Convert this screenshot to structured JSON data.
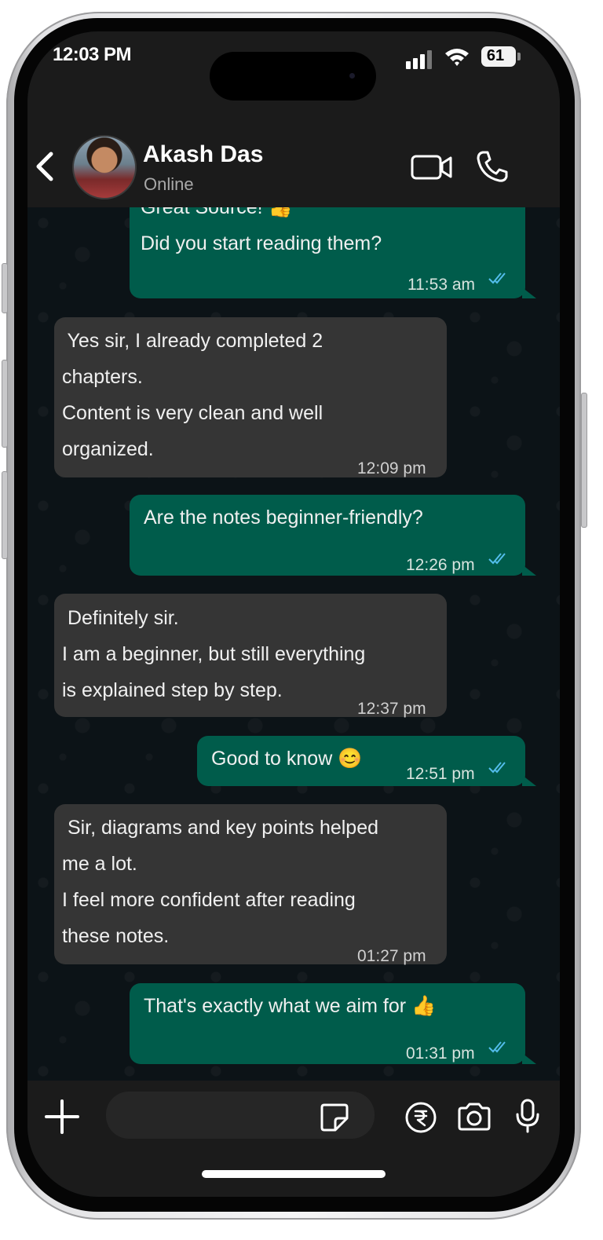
{
  "status_bar": {
    "time": "12:03 PM",
    "battery": "61"
  },
  "header": {
    "contact_name": "Akash Das",
    "contact_status": "Online"
  },
  "messages": [
    {
      "direction": "out",
      "text": "Great Source! 👍\nDid you start reading them?",
      "time": "11:53 am",
      "read": true
    },
    {
      "direction": "in",
      "text": " Yes sir, I already completed 2\nchapters.\nContent is very clean and well\norganized.",
      "time": "12:09 pm"
    },
    {
      "direction": "out",
      "text": "Are the notes beginner-friendly?",
      "time": "12:26 pm",
      "read": true
    },
    {
      "direction": "in",
      "text": " Definitely sir.\nI am a beginner, but still everything\nis explained step by step.",
      "time": "12:37 pm"
    },
    {
      "direction": "out",
      "text": "Good to know 😊",
      "time": "12:51 pm",
      "read": true
    },
    {
      "direction": "in",
      "text": " Sir, diagrams and key points helped\nme a lot.\nI feel more confident after reading\nthese notes.",
      "time": "01:27 pm"
    },
    {
      "direction": "out",
      "text": "That's exactly what we aim for 👍",
      "time": "01:31 pm",
      "read": true
    }
  ],
  "input": {
    "placeholder": ""
  },
  "colors": {
    "outgoing": "#005c4b",
    "incoming": "#353535",
    "read_ticks": "#53bdeb",
    "background": "#0c1317"
  }
}
